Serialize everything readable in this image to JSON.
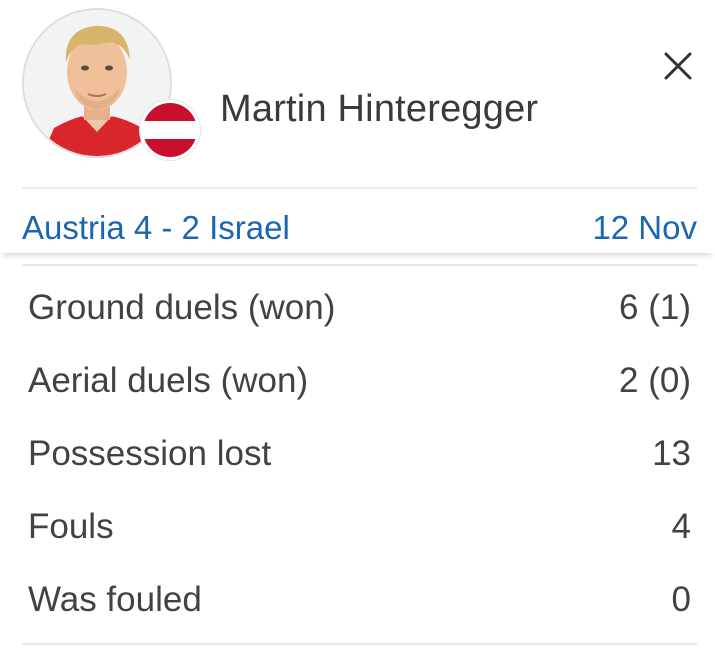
{
  "player": {
    "name": "Martin Hinteregger",
    "avatar_icon": "player-photo-placeholder",
    "flag_icon": "austria-flag-icon",
    "flag_colors": [
      "#c8102e",
      "#ffffff",
      "#c8102e"
    ]
  },
  "match": {
    "title": "Austria 4 - 2 Israel",
    "date": "12 Nov",
    "accent_color": "#1a66b3"
  },
  "stats": [
    {
      "label": "Ground duels (won)",
      "value": "6 (1)"
    },
    {
      "label": "Aerial duels (won)",
      "value": "2 (0)"
    },
    {
      "label": "Possession lost",
      "value": "13"
    },
    {
      "label": "Fouls",
      "value": "4"
    },
    {
      "label": "Was fouled",
      "value": "0"
    }
  ],
  "close_icon": "close-icon"
}
